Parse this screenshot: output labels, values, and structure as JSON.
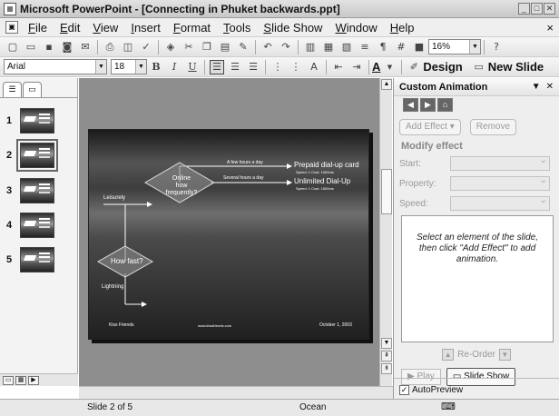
{
  "window": {
    "title": "Microsoft PowerPoint - [Connecting in Phuket backwards.ppt]",
    "controls": [
      "_",
      "□",
      "✕"
    ]
  },
  "menu": {
    "items": [
      "File",
      "Edit",
      "View",
      "Insert",
      "Format",
      "Tools",
      "Slide Show",
      "Window",
      "Help"
    ],
    "close": "×"
  },
  "toolbar1": {
    "zoom": "16%"
  },
  "toolbar2": {
    "font": "Arial",
    "size": "18",
    "bold": "B",
    "italic": "I",
    "underline": "U",
    "font_color": "A",
    "design": "Design",
    "new_slide": "New Slide"
  },
  "slides_pane": {
    "thumbnails": [
      {
        "num": "1"
      },
      {
        "num": "2"
      },
      {
        "num": "3"
      },
      {
        "num": "4"
      },
      {
        "num": "5"
      }
    ]
  },
  "slide": {
    "decision1": "Online\nhow frequently?",
    "decision2": "How fast?",
    "label_leisurely": "Leisurely",
    "label_lightning": "Lightning",
    "label_few_hours": "A few hours a day",
    "label_several_hours": "Several hours a day",
    "result1_title": "Prepaid dial-up card",
    "result1_sub": "Speed: 1 Cost: 1000ms",
    "result2_title": "Unlimited Dial-Up",
    "result2_sub": "Speed: 1 Cost: 1500ms",
    "footer_left": "Kiss Friends",
    "footer_mid": "www.kissfriends.com",
    "footer_right": "October 1, 2003"
  },
  "task_pane": {
    "title": "Custom Animation",
    "add_effect": "Add Effect",
    "remove": "Remove",
    "modify_effect": "Modify effect",
    "start_label": "Start:",
    "property_label": "Property:",
    "speed_label": "Speed:",
    "list_hint": "Select an element of the slide, then click \"Add Effect\" to add animation.",
    "reorder": "Re-Order",
    "play": "Play",
    "slide_show": "Slide Show",
    "autopreview": "AutoPreview"
  },
  "statusbar": {
    "slide_info": "Slide 2 of 5",
    "design": "Ocean"
  }
}
